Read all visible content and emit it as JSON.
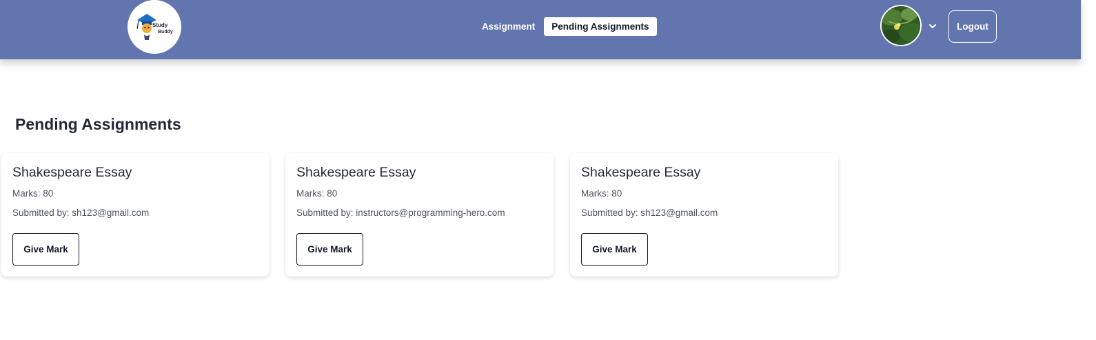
{
  "navbar": {
    "logo": {
      "line1": "Study",
      "line2": "Buddy",
      "icon": "graduation-cap-icon"
    },
    "links": [
      {
        "label": "Assignment",
        "active": false
      },
      {
        "label": "Pending Assignments",
        "active": true
      }
    ],
    "avatar": {
      "icon": "user-avatar-photo"
    },
    "dropdown_icon": "chevron-down-icon",
    "logout_label": "Logout",
    "background_color": "#6375ae"
  },
  "main": {
    "title": "Pending Assignments",
    "cards": [
      {
        "title": "Shakespeare Essay",
        "marks": "Marks: 80",
        "submitted": "Submitted by: sh123@gmail.com",
        "button": "Give Mark"
      },
      {
        "title": "Shakespeare Essay",
        "marks": "Marks: 80",
        "submitted": "Submitted by: instructors@programming-hero.com",
        "button": "Give Mark"
      },
      {
        "title": "Shakespeare Essay",
        "marks": "Marks: 80",
        "submitted": "Submitted by: sh123@gmail.com",
        "button": "Give Mark"
      }
    ]
  }
}
